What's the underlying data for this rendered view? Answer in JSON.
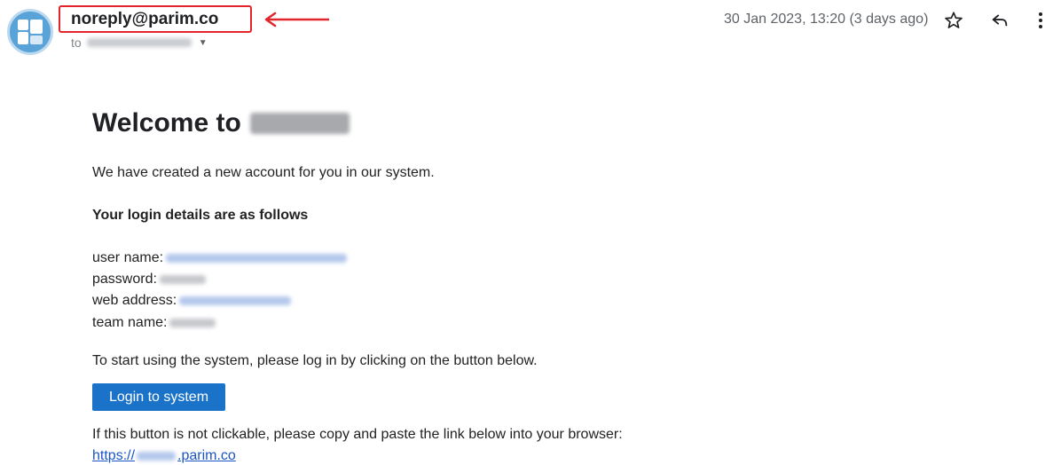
{
  "header": {
    "sender": "noreply@parim.co",
    "to_label": "to",
    "date": "30 Jan 2023, 13:20 (3 days ago)",
    "icons": [
      "avatar-logo-icon",
      "star-icon",
      "reply-icon",
      "more-vert-icon",
      "chevron-down-icon",
      "red-arrow-icon"
    ],
    "colors": {
      "highlight_box": "#e3242b",
      "avatar": "#5aa3d8"
    }
  },
  "email": {
    "title_prefix": "Welcome to",
    "intro": "We have created a new account for you in our system.",
    "details_heading": "Your login details are as follows",
    "labels": {
      "user_name": "user name:",
      "password": "password:",
      "web_address": "web address:",
      "team_name": "team name:"
    },
    "instructions": "To start using the system, please log in by clicking on the button below.",
    "login_button": "Login to system",
    "fallback_text": "If this button is not clickable, please copy and paste the link below into your browser:",
    "link_prefix": "https://",
    "link_suffix": ".parim.co",
    "colors": {
      "button": "#1a73c9",
      "link": "#1a55c4"
    }
  }
}
